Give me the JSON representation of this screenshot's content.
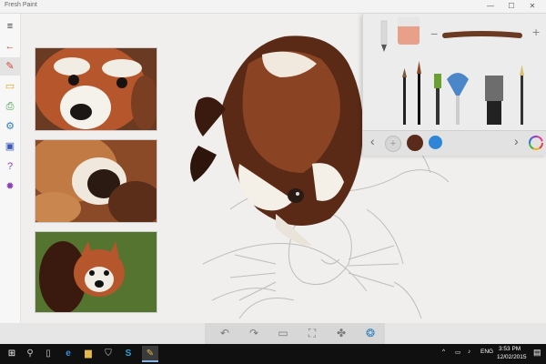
{
  "window": {
    "title": "Fresh Paint",
    "minimize": "—",
    "maximize": "☐",
    "close": "✕"
  },
  "sidebar": [
    {
      "name": "hamburger-menu-icon",
      "glyph": "≡",
      "color": "#333"
    },
    {
      "name": "back-arrow-icon",
      "glyph": "←",
      "color": "#d4463b"
    },
    {
      "name": "new-page-icon",
      "glyph": "✎",
      "color": "#d4463b"
    },
    {
      "name": "open-icon",
      "glyph": "▭",
      "color": "#e0a30d"
    },
    {
      "name": "print-icon",
      "glyph": "⎙",
      "color": "#2e9a3a"
    },
    {
      "name": "share-icon",
      "glyph": "⚙",
      "color": "#2f7fc1"
    },
    {
      "name": "save-icon",
      "glyph": "▣",
      "color": "#3b57b8"
    },
    {
      "name": "help-icon",
      "glyph": "?",
      "color": "#8a3fb5"
    },
    {
      "name": "settings-icon",
      "glyph": "✹",
      "color": "#8a3fb5"
    }
  ],
  "brush_panel": {
    "minus_label": "−",
    "plus_label": "+",
    "prev_label": "‹",
    "next_label": "›",
    "palette_colors": [
      "#5a2a1a",
      "#2f86d6"
    ]
  },
  "bottom_toolbar": {
    "undo": "↶",
    "redo": "↷",
    "canvas": "▭",
    "fit": "⛶",
    "fan": "✤",
    "gallery": "❂"
  },
  "taskbar": {
    "start": "⊞",
    "search": "⚲",
    "task_view": "▯",
    "edge": "e",
    "explorer": "▆",
    "store": "⛉",
    "skype": "S",
    "fresh_paint": "✎",
    "tray_up": "^",
    "network": "▭",
    "volume": "♪",
    "language": "ENG",
    "time": "3:53 PM",
    "date": "12/02/2015",
    "notifications": "▤"
  }
}
